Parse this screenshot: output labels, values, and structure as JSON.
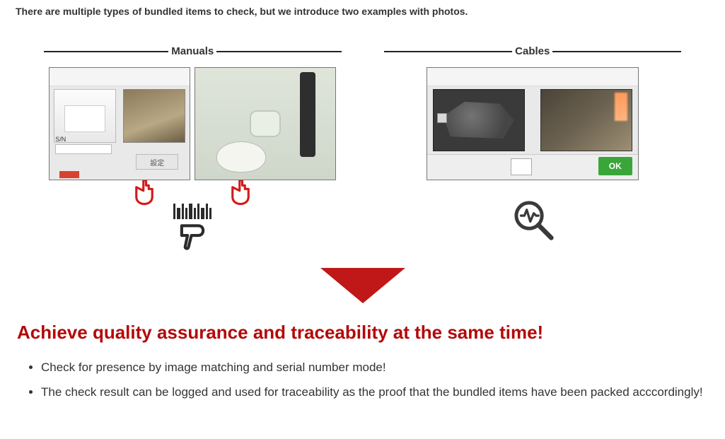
{
  "intro_text": "There are multiple types of bundled items to check, but we introduce two examples with photos.",
  "examples": {
    "manuals": {
      "title": "Manuals",
      "photo1": {
        "sn_label": "S/N",
        "button_label": "設定"
      },
      "icon_names": {
        "hand_left": "hand-pointer-icon",
        "hand_right": "hand-pointer-icon",
        "scanner": "barcode-scanner-icon"
      }
    },
    "cables": {
      "title": "Cables",
      "photo": {
        "ok_label": "OK"
      },
      "icon_name": "inspect-magnifier-icon"
    }
  },
  "arrow_color": "#c01818",
  "headline": "Achieve quality assurance and traceability at the same time!",
  "points": [
    "Check for presence by image matching and serial number mode!",
    "The check result can be logged and used for traceability as the proof that the bundled items have been packed acccordingly!"
  ]
}
